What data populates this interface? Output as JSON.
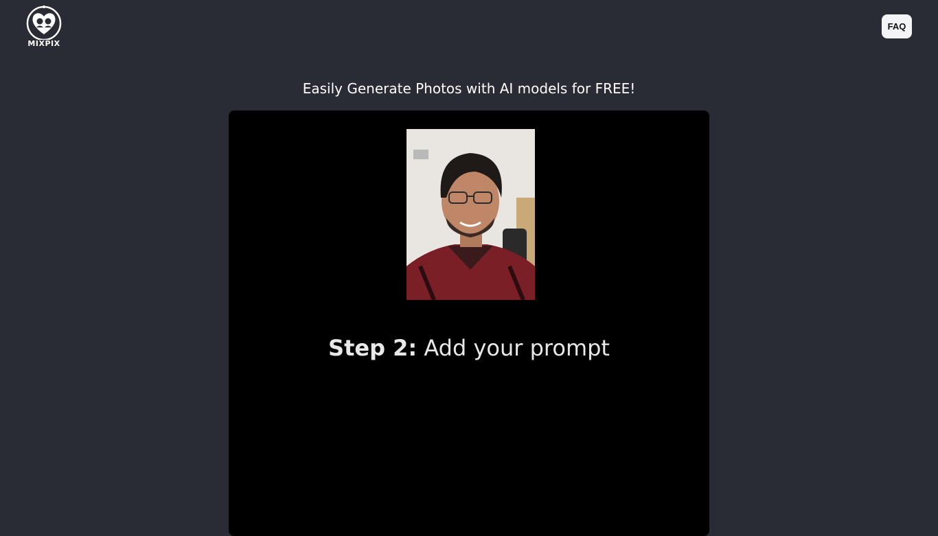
{
  "header": {
    "logo_text": "MIXPIX",
    "logo_icon": "heart-faces-logo-icon",
    "faq_label": "FAQ"
  },
  "main": {
    "headline": "Easily Generate Photos with AI models for FREE!",
    "video": {
      "step_label": "Step 2:",
      "step_text": " Add your prompt"
    }
  },
  "colors": {
    "background": "#292c35",
    "video_background": "#000000",
    "faq_button_bg": "#f3f4f6",
    "text_light": "#ffffff"
  }
}
